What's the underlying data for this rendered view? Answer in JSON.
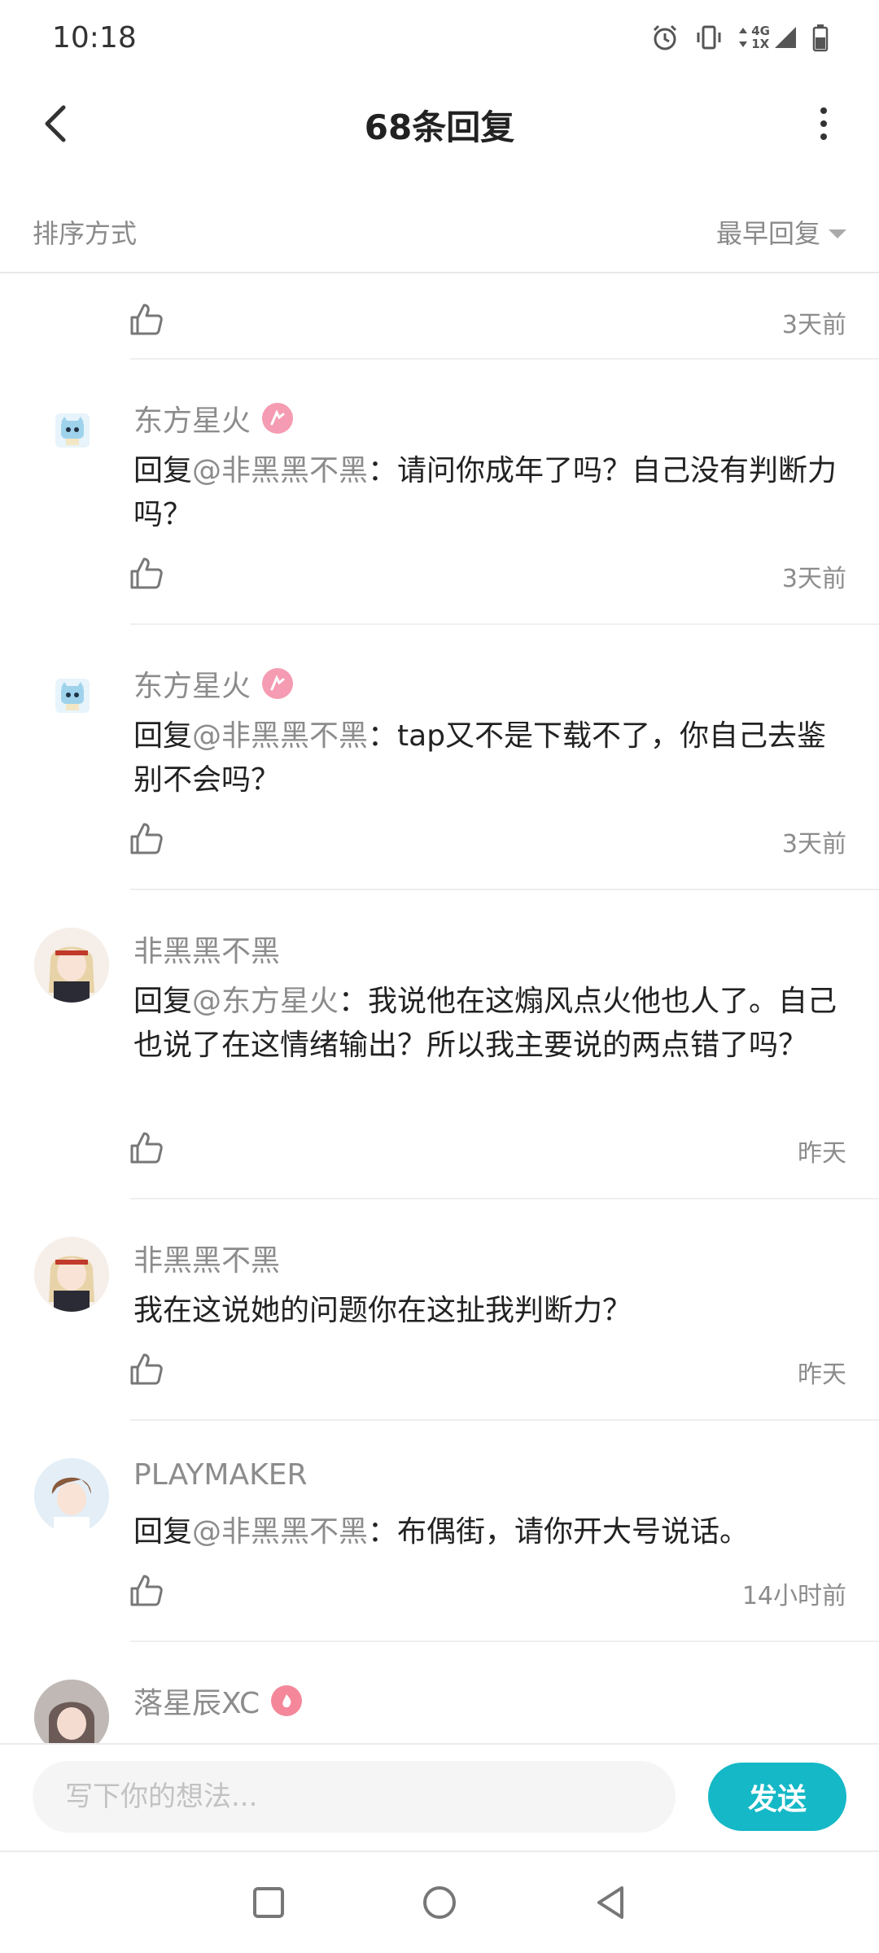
{
  "status_bar": {
    "time": "10:18",
    "network_top": "4G",
    "network_bottom": "1X"
  },
  "header": {
    "title": "68条回复"
  },
  "sort": {
    "label": "排序方式",
    "selected": "最早回复"
  },
  "comments": [
    {
      "time": "3天前"
    },
    {
      "username": "东方星火",
      "reply_prefix": "回复",
      "mention": "@非黑黑不黑",
      "text": "：请问你成年了吗？自己没有判断力吗？",
      "time": "3天前"
    },
    {
      "username": "东方星火",
      "reply_prefix": "回复",
      "mention": "@非黑黑不黑",
      "text": "：tap又不是下载不了，你自己去鉴别不会吗？",
      "time": "3天前"
    },
    {
      "username": "非黑黑不黑",
      "reply_prefix": "回复",
      "mention": "@东方星火",
      "text": "：我说他在这煽风点火他也人了。自己也说了在这情绪输出？所以我主要说的两点错了吗？",
      "time": "昨天"
    },
    {
      "username": "非黑黑不黑",
      "text": "我在这说她的问题你在这扯我判断力？",
      "time": "昨天"
    },
    {
      "username": "PLAYMAKER",
      "reply_prefix": "回复",
      "mention": "@非黑黑不黑",
      "text": "：布偶街，请你开大号说话。",
      "time": "14小时前"
    },
    {
      "username": "落星辰XC"
    }
  ],
  "input": {
    "placeholder": "写下你的想法...",
    "value": ""
  },
  "send_button": {
    "label": "发送"
  },
  "colors": {
    "accent": "#15b8c6",
    "muted_text": "#8c8c8c",
    "badge": "#f59bb2"
  }
}
